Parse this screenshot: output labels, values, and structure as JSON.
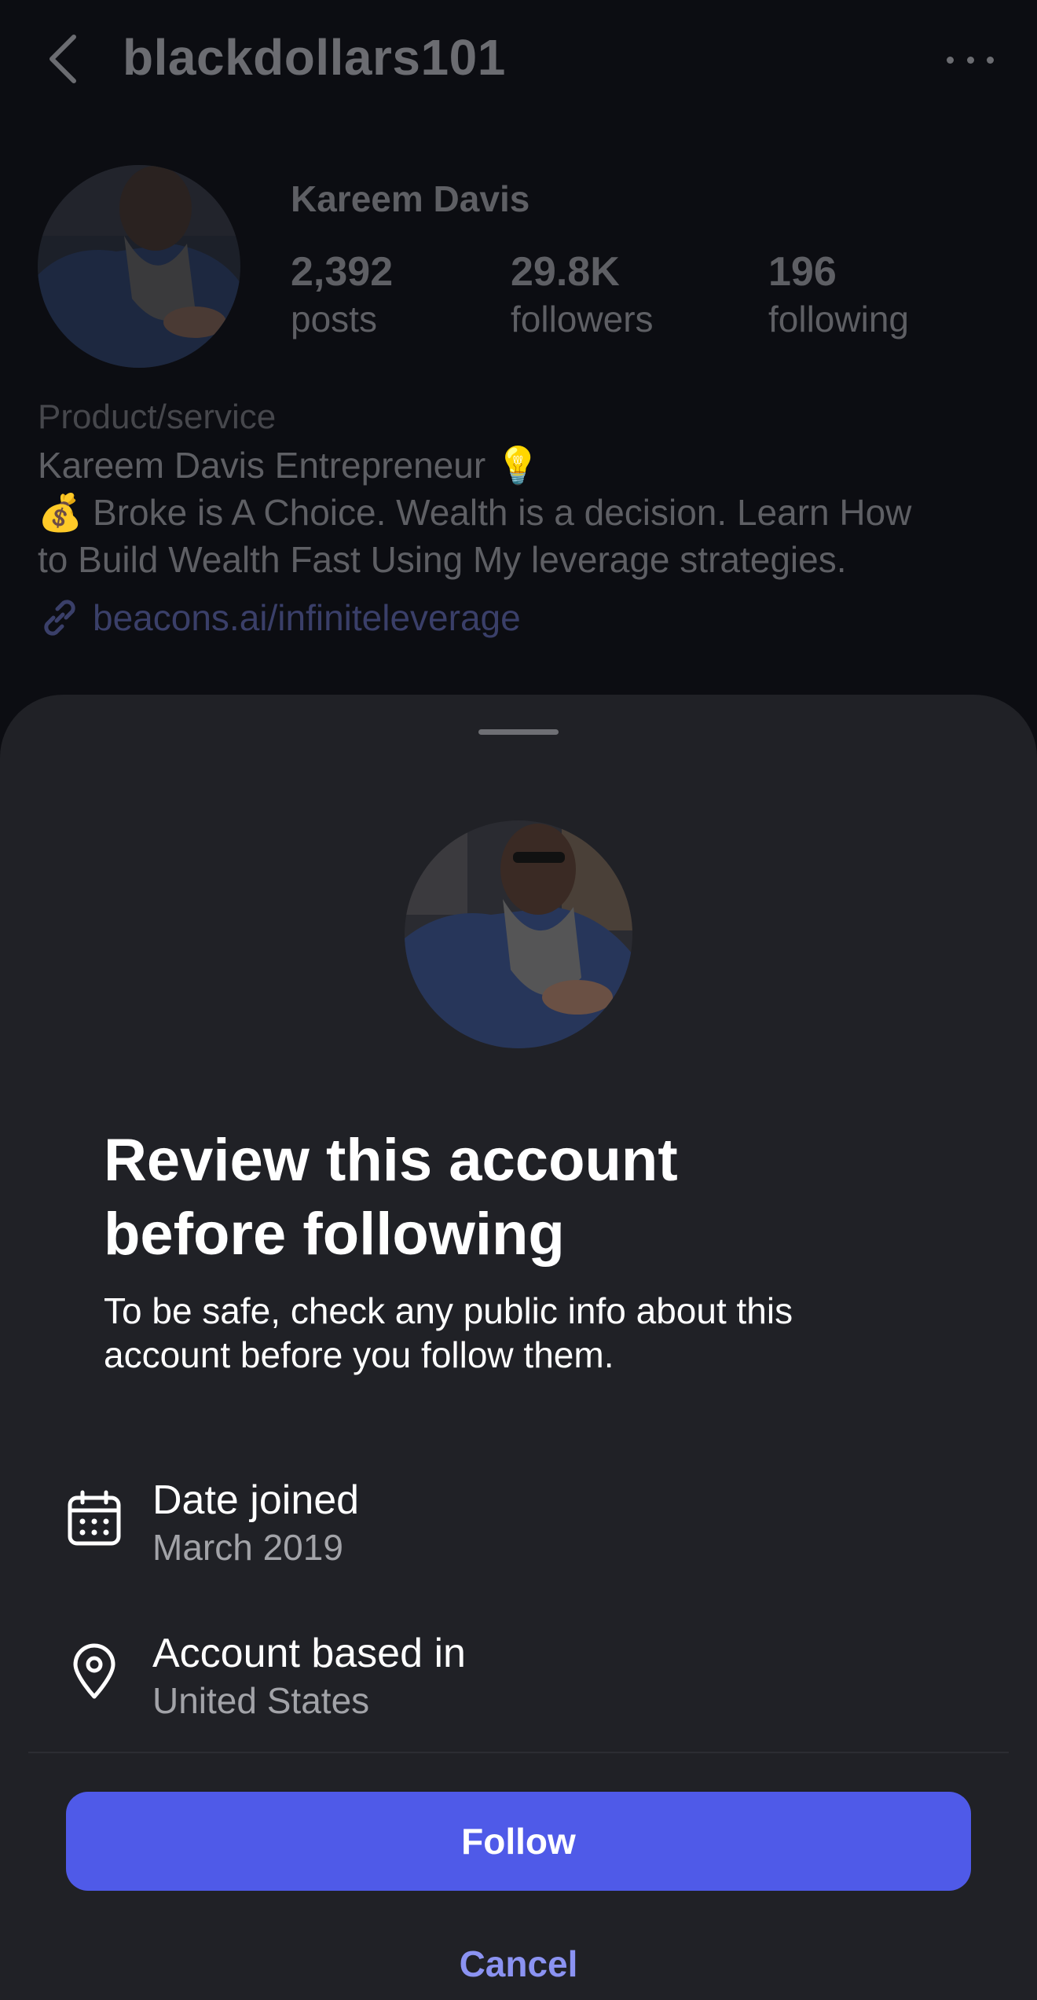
{
  "header": {
    "username": "blackdollars101",
    "back_icon": "chevron-left-icon",
    "more_icon": "more-horizontal-icon"
  },
  "profile": {
    "display_name": "Kareem Davis",
    "stats": [
      {
        "value": "2,392",
        "label": "posts"
      },
      {
        "value": "29.8K",
        "label": "followers"
      },
      {
        "value": "196",
        "label": "following"
      }
    ],
    "category": "Product/service",
    "bio_lines": [
      "Kareem Davis Entrepreneur 💡",
      "💰 Broke is A Choice. Wealth is a decision. Learn How",
      "to Build Wealth Fast Using My leverage strategies."
    ],
    "link": "beacons.ai/infiniteleverage",
    "link_icon": "link-icon"
  },
  "sheet": {
    "title_lines": [
      "Review this account",
      "before following"
    ],
    "description_lines": [
      "To be safe, check any public info about this",
      "account before you follow them."
    ],
    "info": [
      {
        "label": "Date joined",
        "value": "March 2019",
        "icon": "calendar-icon"
      },
      {
        "label": "Account based in",
        "value": "United States",
        "icon": "location-pin-icon"
      }
    ],
    "follow_label": "Follow",
    "cancel_label": "Cancel"
  },
  "colors": {
    "accent": "#4f5ae8",
    "cancel": "#8b93f2",
    "sheet_bg": "#202126",
    "page_bg": "#0c0d12"
  }
}
